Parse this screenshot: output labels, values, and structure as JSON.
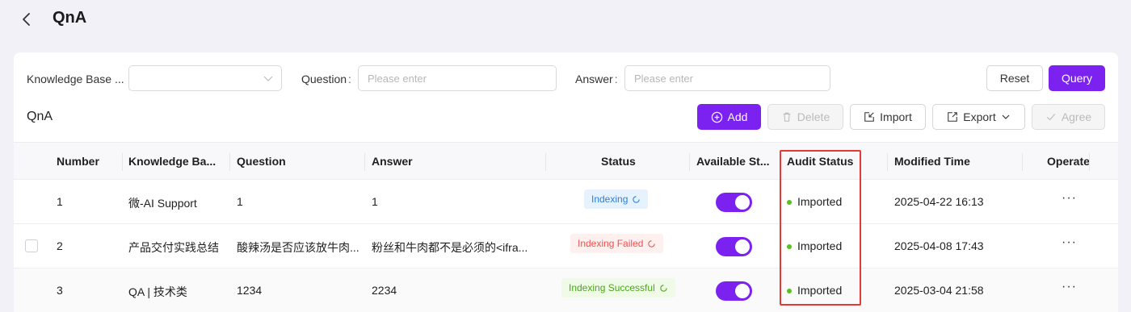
{
  "header": {
    "title": "QnA"
  },
  "filters": {
    "kb_label": "Knowledge Base ...",
    "question_label": "Question",
    "question_placeholder": "Please enter",
    "answer_label": "Answer",
    "answer_placeholder": "Please enter",
    "reset": "Reset",
    "query": "Query"
  },
  "toolbar": {
    "title": "QnA",
    "add": "Add",
    "delete": "Delete",
    "import": "Import",
    "export": "Export",
    "agree": "Agree"
  },
  "table": {
    "columns": [
      "Number",
      "Knowledge Ba...",
      "Question",
      "Answer",
      "Status",
      "Available St...",
      "Audit Status",
      "Modified Time",
      "Operate"
    ],
    "rows": [
      {
        "number": "1",
        "kb": "微-AI Support",
        "question": "1",
        "answer": "1",
        "status": "Indexing",
        "status_color": "blue",
        "available": true,
        "audit": "Imported",
        "modified": "2025-04-22 16:13",
        "more": "···"
      },
      {
        "number": "2",
        "kb": "产品交付实践总结",
        "question": "酸辣汤是否应该放牛肉...",
        "answer": "粉丝和牛肉都不是必须的<ifra...",
        "status": "Indexing Failed",
        "status_color": "red",
        "available": true,
        "audit": "Imported",
        "modified": "2025-04-08 17:43",
        "more": "···"
      },
      {
        "number": "3",
        "kb": "QA | 技术类",
        "question": "1234",
        "answer": "2234",
        "status": "Indexing Successful",
        "status_color": "green",
        "available": true,
        "audit": "Imported",
        "modified": "2025-03-04 21:58",
        "more": "···"
      }
    ]
  },
  "colors": {
    "primary": "#7b22f0",
    "highlight": "#e53935",
    "success": "#52c41a"
  }
}
